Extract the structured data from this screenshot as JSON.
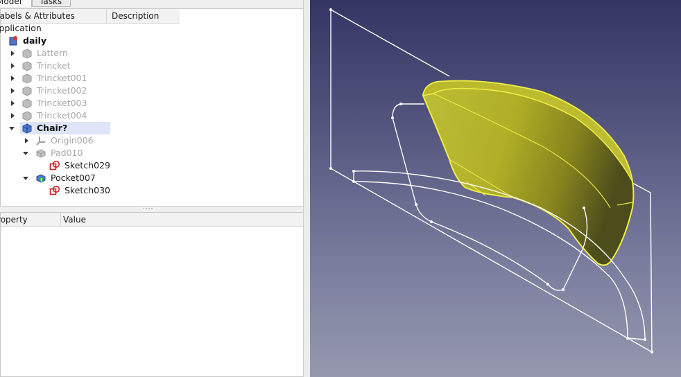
{
  "tabs": [
    {
      "label": "Model"
    },
    {
      "label": "Tasks"
    }
  ],
  "tree": {
    "columns": [
      "Labels & Attributes",
      "Description"
    ],
    "root_label": "Application",
    "document": "daily",
    "items": [
      {
        "label": "Lattern",
        "state": "hidden"
      },
      {
        "label": "Trincket",
        "state": "hidden"
      },
      {
        "label": "Trincket001",
        "state": "hidden"
      },
      {
        "label": "Trincket002",
        "state": "hidden"
      },
      {
        "label": "Trincket003",
        "state": "hidden"
      },
      {
        "label": "Trincket004",
        "state": "hidden"
      },
      {
        "label": "Chair?",
        "state": "active"
      },
      {
        "label": "Origin006",
        "state": "hidden"
      },
      {
        "label": "Pad010",
        "state": "hidden"
      },
      {
        "label": "Sketch029",
        "state": "visible"
      },
      {
        "label": "Pocket007",
        "state": "visible"
      },
      {
        "label": "Sketch030",
        "state": "visible"
      }
    ]
  },
  "property_view": {
    "columns": [
      "Property",
      "Value"
    ]
  },
  "colors": {
    "selection": "#dfe4f8",
    "hidden_text": "#a8a8a8",
    "solid_fill": "#c9c92a",
    "wire": "#ffffff",
    "view_top": "#343563",
    "view_bottom": "#9598ae"
  },
  "icons": [
    "document-icon",
    "body-icon",
    "origin-icon",
    "pad-icon",
    "sketch-icon",
    "pocket-icon",
    "expand-arrow-icon",
    "collapse-arrow-icon"
  ]
}
